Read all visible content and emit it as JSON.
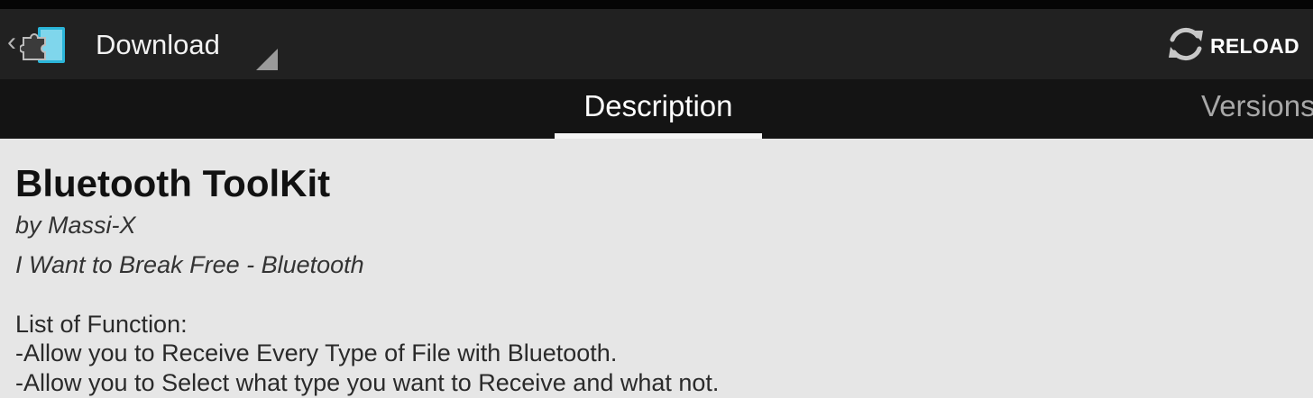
{
  "action_bar": {
    "spinner_label": "Download",
    "reload_label": "RELOAD"
  },
  "icons": {
    "up": "chevron-left-icon",
    "app": "xposed-puzzle-icon",
    "spinner": "spinner-triangle-icon",
    "reload": "refresh-icon"
  },
  "tabs": [
    {
      "label": "Description",
      "selected": true
    },
    {
      "label": "Versions",
      "selected": false
    }
  ],
  "module": {
    "title": "Bluetooth ToolKit",
    "author": "by Massi-X",
    "summary": "I Want to Break Free - Bluetooth",
    "description_lines": [
      "List of Function:",
      "-Allow you to Receive Every Type of File with Bluetooth.",
      "-Allow you to Select what type you want to Receive and what not."
    ]
  },
  "colors": {
    "action_bar": "#212121",
    "tab_bar": "#141414",
    "content_bg": "#e6e6e6",
    "app_icon_accent": "#2bb5d9"
  }
}
